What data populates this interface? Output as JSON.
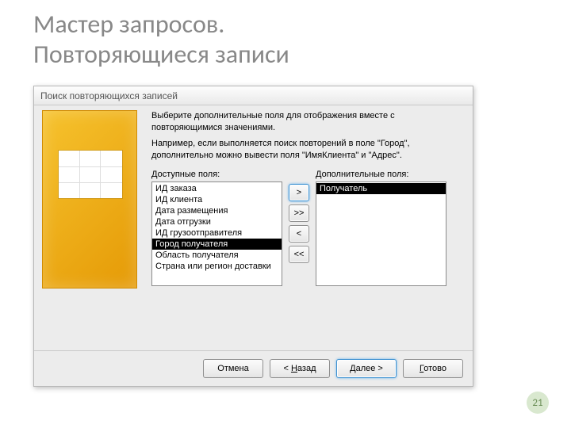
{
  "slide": {
    "title_line1": "Мастер запросов.",
    "title_line2": "Повторяющиеся записи",
    "page_number": "21"
  },
  "dialog": {
    "title": "Поиск повторяющихся записей",
    "instructions": {
      "p1": "Выберите дополнительные поля для отображения вместе с повторяющимися значениями.",
      "p2": "Например, если выполняется поиск повторений в поле \"Город\", дополнительно можно вывести поля \"ИмяКлиента\" и \"Адрес\"."
    },
    "labels": {
      "available": "Доступные поля:",
      "additional": "Дополнительные поля:"
    },
    "available_fields": [
      "ИД заказа",
      "ИД клиента",
      "Дата размещения",
      "Дата отгрузки",
      "ИД грузоотправителя",
      "Город получателя",
      "Область получателя",
      "Страна или регион доставки"
    ],
    "available_selected_index": 5,
    "additional_fields": [
      "Получатель"
    ],
    "additional_selected_index": 0,
    "mover": {
      "add": ">",
      "add_all": ">>",
      "remove": "<",
      "remove_all": "<<"
    },
    "buttons": {
      "cancel": "Отмена",
      "back_prefix": "< ",
      "back_u": "Н",
      "back_suffix": "азад",
      "next_prefix": "",
      "next_u": "Д",
      "next_suffix": "алее >",
      "finish_prefix": "",
      "finish_u": "Г",
      "finish_suffix": "отово"
    }
  }
}
